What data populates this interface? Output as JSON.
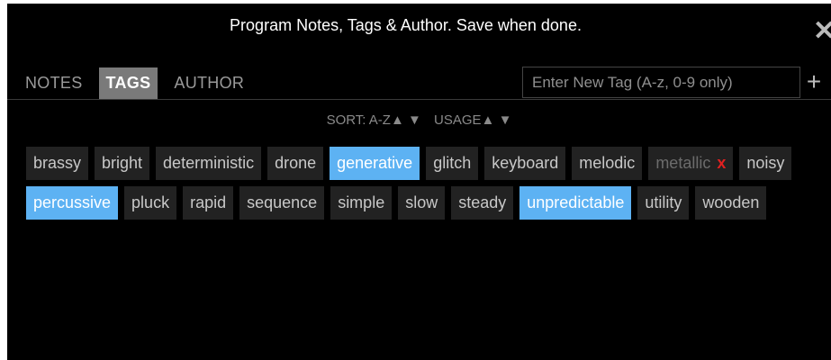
{
  "header": {
    "title": "Program Notes, Tags & Author. Save when done.",
    "close_label": "✕"
  },
  "tabs": [
    {
      "label": "NOTES",
      "active": false
    },
    {
      "label": "TAGS",
      "active": true
    },
    {
      "label": "AUTHOR",
      "active": false
    }
  ],
  "new_tag": {
    "placeholder": "Enter New Tag (A-z, 0-9 only)",
    "add_label": "+"
  },
  "sort": {
    "az_label": "SORT: A-Z",
    "usage_label": "USAGE",
    "up_arrow": "▲",
    "down_arrow": "▼"
  },
  "tags": [
    {
      "label": "brassy",
      "state": "normal"
    },
    {
      "label": "bright",
      "state": "normal"
    },
    {
      "label": "deterministic",
      "state": "normal"
    },
    {
      "label": "drone",
      "state": "normal"
    },
    {
      "label": "generative",
      "state": "selected"
    },
    {
      "label": "glitch",
      "state": "normal"
    },
    {
      "label": "keyboard",
      "state": "normal"
    },
    {
      "label": "melodic",
      "state": "normal"
    },
    {
      "label": "metallic",
      "state": "disabled",
      "remove_label": "x"
    },
    {
      "label": "noisy",
      "state": "normal"
    },
    {
      "label": "percussive",
      "state": "selected"
    },
    {
      "label": "pluck",
      "state": "normal"
    },
    {
      "label": "rapid",
      "state": "normal"
    },
    {
      "label": "sequence",
      "state": "normal"
    },
    {
      "label": "simple",
      "state": "normal"
    },
    {
      "label": "slow",
      "state": "normal"
    },
    {
      "label": "steady",
      "state": "normal"
    },
    {
      "label": "unpredictable",
      "state": "selected"
    },
    {
      "label": "utility",
      "state": "normal"
    },
    {
      "label": "wooden",
      "state": "normal"
    }
  ],
  "colors": {
    "background": "#000000",
    "tag_background": "#222222",
    "selected_tag": "#5db2f3",
    "active_tab": "#7a7a7a",
    "remove_x": "#e02020"
  }
}
